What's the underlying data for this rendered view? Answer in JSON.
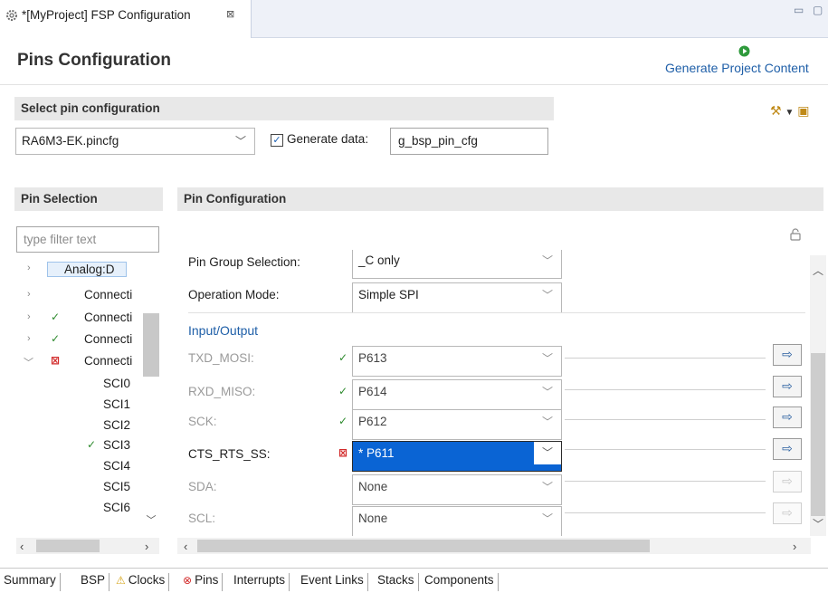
{
  "editor_tab": {
    "title": "*[MyProject] FSP Configuration",
    "close": "⊠"
  },
  "window_controls": {
    "minimize": "▭",
    "maximize": "▢"
  },
  "header": {
    "title": "Pins Configuration",
    "generate_label": "Generate Project Content"
  },
  "select_config": {
    "heading": "Select pin configuration",
    "selected": "RA6M3-EK.pincfg",
    "generate_checked": true,
    "generate_label": "Generate data:",
    "generate_value": "g_bsp_pin_cfg"
  },
  "pin_selection": {
    "heading": "Pin Selection",
    "filter_placeholder": "type filter text",
    "tree": [
      {
        "label": "Analog:D",
        "chevron": ">",
        "mark": ""
      },
      {
        "label": "Connecti",
        "chevron": ">",
        "mark": ""
      },
      {
        "label": "Connecti",
        "chevron": ">",
        "mark": "check"
      },
      {
        "label": "Connecti",
        "chevron": ">",
        "mark": "check"
      },
      {
        "label": "Connecti",
        "chevron": "v",
        "mark": "error"
      },
      {
        "label": "SCI0",
        "chevron": "",
        "mark": ""
      },
      {
        "label": "SCI1",
        "chevron": "",
        "mark": ""
      },
      {
        "label": "SCI2",
        "chevron": "",
        "mark": ""
      },
      {
        "label": "SCI3",
        "chevron": "",
        "mark": "check"
      },
      {
        "label": "SCI4",
        "chevron": "",
        "mark": ""
      },
      {
        "label": "SCI5",
        "chevron": "",
        "mark": ""
      },
      {
        "label": "SCI6",
        "chevron": "",
        "mark": ""
      }
    ]
  },
  "pin_configuration": {
    "heading": "Pin Configuration",
    "pin_group_label": "Pin Group Selection:",
    "pin_group_value": "_C only",
    "operation_mode_label": "Operation Mode:",
    "operation_mode_value": "Simple SPI",
    "io_heading": "Input/Output",
    "rows": [
      {
        "label": "TXD_MOSI:",
        "value": "P613",
        "status": "check",
        "enabled": false
      },
      {
        "label": "RXD_MISO:",
        "value": "P614",
        "status": "check",
        "enabled": false
      },
      {
        "label": "SCK:",
        "value": "P612",
        "status": "check",
        "enabled": false
      },
      {
        "label": "CTS_RTS_SS:",
        "value": "* P611",
        "status": "error",
        "enabled": true
      },
      {
        "label": "SDA:",
        "value": "None",
        "status": "",
        "enabled": false
      },
      {
        "label": "SCL:",
        "value": "None",
        "status": "",
        "enabled": false
      }
    ]
  },
  "bottom_tabs": [
    "Summary",
    "BSP",
    "Clocks",
    "Pins",
    "Interrupts",
    "Event Links",
    "Stacks",
    "Components"
  ],
  "colors": {
    "link": "#1f5fa8",
    "check": "#2e8b2e",
    "error": "#d22b2b",
    "selection": "#0a64d4"
  }
}
